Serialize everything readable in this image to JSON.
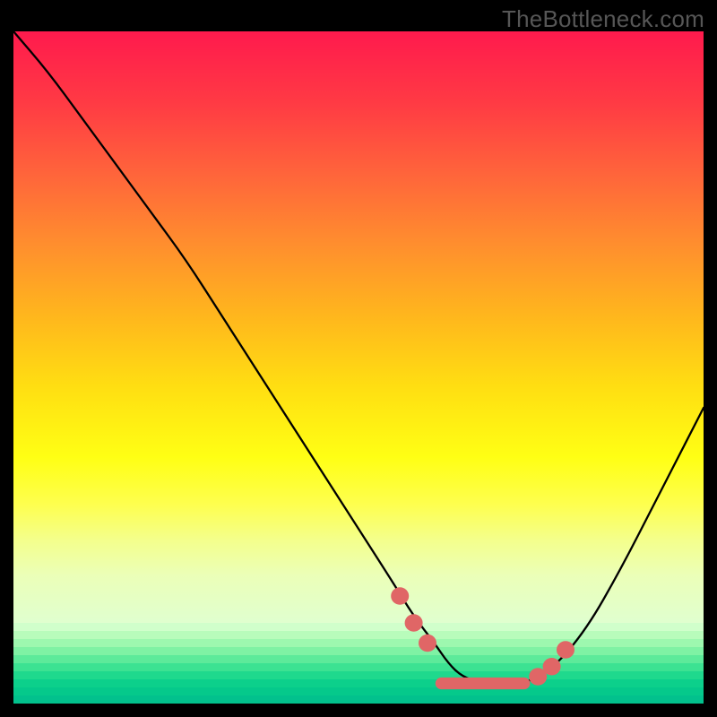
{
  "watermark": "TheBottleneck.com",
  "colors": {
    "page_bg": "#000000",
    "gradient_top": "#ff1a4d",
    "gradient_mid": "#ffde12",
    "gradient_bottom": "#e0ffcf",
    "curve": "#000000",
    "marker": "#e06666",
    "green_bands": [
      "#d0ffcb",
      "#b8fcbb",
      "#9df8af",
      "#7ff2a4",
      "#5dea9a",
      "#3ce292",
      "#1fd98d",
      "#0cd08b",
      "#05c98b",
      "#02c18d"
    ]
  },
  "chart_data": {
    "type": "line",
    "title": "",
    "xlabel": "",
    "ylabel": "",
    "xlim": [
      0,
      100
    ],
    "ylim": [
      0,
      100
    ],
    "legend": false,
    "annotations": [],
    "series": [
      {
        "name": "bottleneck-curve",
        "x": [
          0,
          5,
          10,
          15,
          20,
          25,
          30,
          35,
          40,
          45,
          50,
          55,
          58,
          61,
          63,
          65,
          68,
          71,
          74,
          78,
          83,
          88,
          93,
          98,
          100
        ],
        "y": [
          100,
          94,
          87,
          80,
          73,
          66,
          58,
          50,
          42,
          34,
          26,
          18,
          13,
          9,
          6,
          4,
          3,
          2.5,
          3,
          5,
          11,
          20,
          30,
          40,
          44
        ]
      }
    ],
    "markers": [
      {
        "name": "marker-left-1",
        "x": 56,
        "y": 16,
        "r": 1.3
      },
      {
        "name": "marker-left-2",
        "x": 58,
        "y": 12,
        "r": 1.3
      },
      {
        "name": "marker-left-3",
        "x": 60,
        "y": 9,
        "r": 1.3
      },
      {
        "name": "valley-bar",
        "type": "bar",
        "x0": 62,
        "x1": 74,
        "y": 3,
        "thickness": 2.2
      },
      {
        "name": "marker-right-1",
        "x": 76,
        "y": 4,
        "r": 1.3
      },
      {
        "name": "marker-right-2",
        "x": 78,
        "y": 5.5,
        "r": 1.3
      },
      {
        "name": "marker-right-3",
        "x": 80,
        "y": 8,
        "r": 1.3
      }
    ]
  }
}
